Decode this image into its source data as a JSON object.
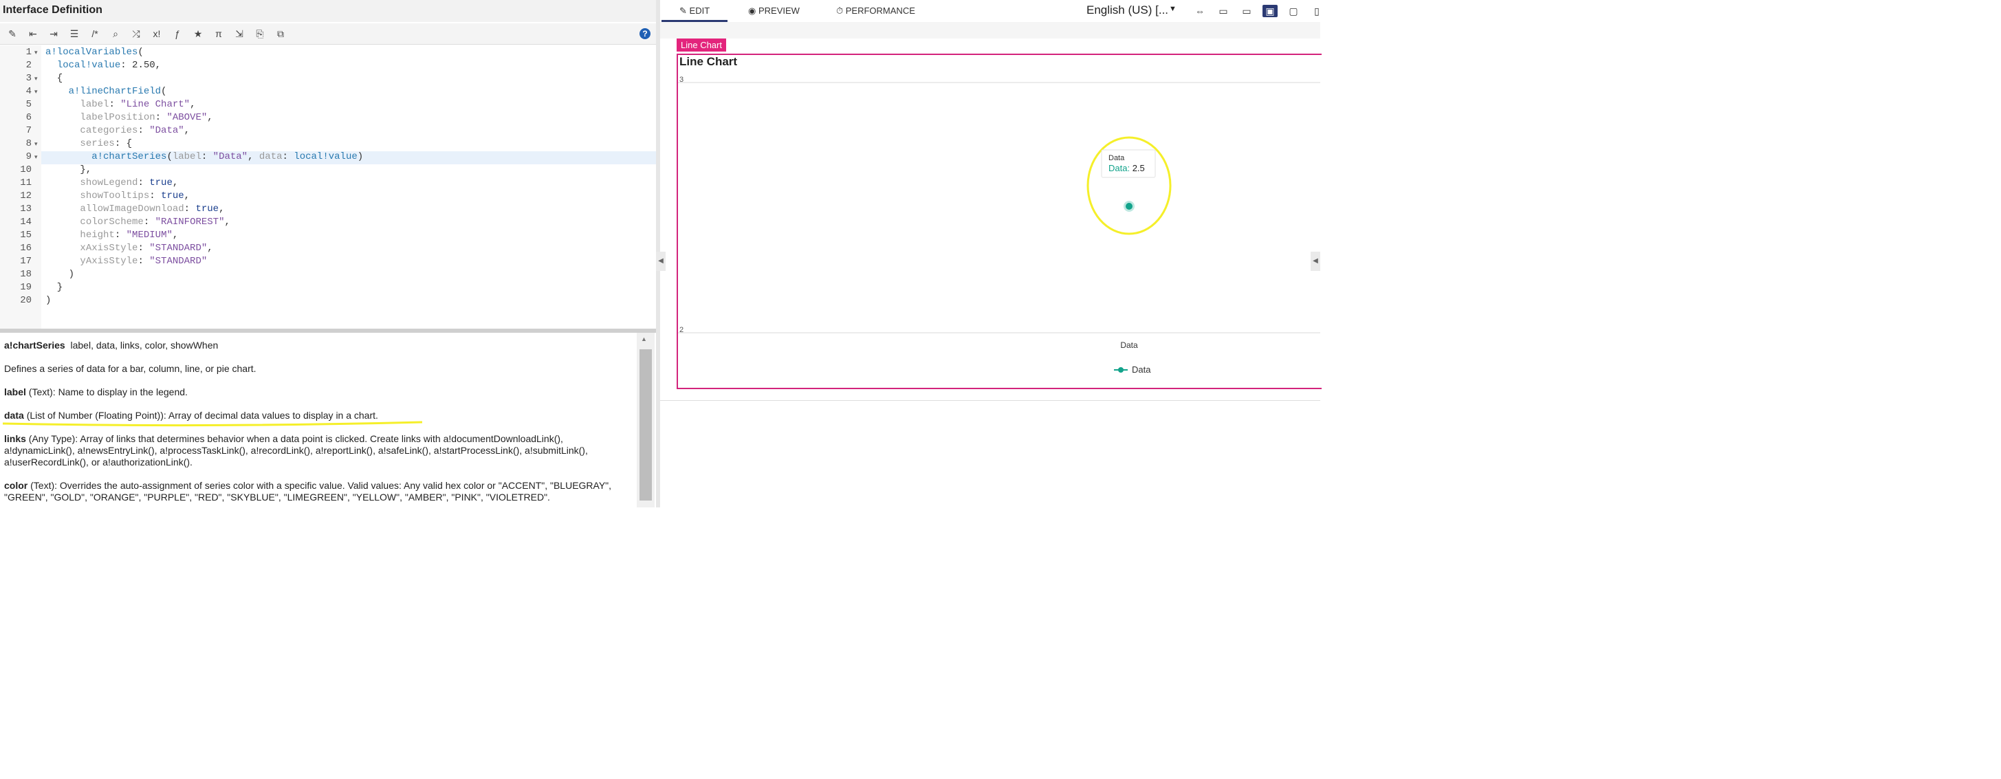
{
  "left": {
    "title": "Interface Definition",
    "help": "?",
    "toolbar": [
      {
        "icon": "wand-icon",
        "glyph": "✎"
      },
      {
        "icon": "outdent-icon",
        "glyph": "⇤"
      },
      {
        "icon": "indent-icon",
        "glyph": "⇥"
      },
      {
        "icon": "format-icon",
        "glyph": "☰"
      },
      {
        "icon": "comment-icon",
        "glyph": "/*"
      },
      {
        "icon": "search-icon",
        "glyph": "⌕"
      },
      {
        "icon": "shuffle-icon",
        "glyph": "⤮"
      },
      {
        "icon": "expression-icon",
        "glyph": "x!"
      },
      {
        "icon": "function-icon",
        "glyph": "ƒ"
      },
      {
        "icon": "star-icon",
        "glyph": "★"
      },
      {
        "icon": "pi-icon",
        "glyph": "π"
      },
      {
        "icon": "export-icon",
        "glyph": "⇲"
      },
      {
        "icon": "copy-icon",
        "glyph": "⎘"
      },
      {
        "icon": "layers-icon",
        "glyph": "⧉"
      }
    ],
    "code_lines": [
      "a!localVariables(",
      "  local!value: 2.50,",
      "  {",
      "    a!lineChartField(",
      "      label: \"Line Chart\",",
      "      labelPosition: \"ABOVE\",",
      "      categories: \"Data\",",
      "      series: {",
      "        a!chartSeries(label: \"Data\", data: local!value)",
      "      },",
      "      showLegend: true,",
      "      showTooltips: true,",
      "      allowImageDownload: true,",
      "      colorScheme: \"RAINFOREST\",",
      "      height: \"MEDIUM\",",
      "      xAxisStyle: \"STANDARD\",",
      "      yAxisStyle: \"STANDARD\"",
      "    )",
      "  }",
      ")"
    ],
    "fold_lines": [
      1,
      3,
      4,
      8,
      9
    ],
    "doc": {
      "fn_name": "a!chartSeries",
      "fn_params": "label, data, links, color, showWhen",
      "description": "Defines a series of data for a bar, column, line, or pie chart.",
      "label_name": "label",
      "label_desc": "(Text): Name to display in the legend.",
      "data_name": "data",
      "data_desc": "(List of Number (Floating Point)): Array of decimal data values to display in a chart.",
      "links_name": "links",
      "links_desc": "(Any Type): Array of links that determines behavior when a data point is clicked. Create links with a!documentDownloadLink(), a!dynamicLink(), a!newsEntryLink(), a!processTaskLink(), a!recordLink(), a!reportLink(), a!safeLink(), a!startProcessLink(), a!submitLink(), a!userRecordLink(), or a!authorizationLink().",
      "color_name": "color",
      "color_desc": "(Text): Overrides the auto-assignment of series color with a specific value. Valid values: Any valid hex color or \"ACCENT\", \"BLUEGRAY\", \"GREEN\", \"GOLD\", \"ORANGE\", \"PURPLE\", \"RED\", \"SKYBLUE\", \"LIMEGREEN\", \"YELLOW\", \"AMBER\", \"PINK\", \"VIOLETRED\"."
    }
  },
  "right": {
    "tabs": [
      {
        "label": "EDIT",
        "icon": "edit-icon",
        "glyph": "✎"
      },
      {
        "label": "PREVIEW",
        "icon": "eye-icon",
        "glyph": "◉"
      },
      {
        "label": "PERFORMANCE",
        "icon": "timer-icon",
        "glyph": "⏱"
      }
    ],
    "language": "English (US) [...",
    "devices": [
      {
        "icon": "fit-width-icon",
        "glyph": "⇔"
      },
      {
        "icon": "desktop-icon",
        "glyph": "▭"
      },
      {
        "icon": "monitor-icon",
        "glyph": "▭"
      },
      {
        "icon": "laptop-icon",
        "glyph": "▣"
      },
      {
        "icon": "tablet-icon",
        "glyph": "▢"
      },
      {
        "icon": "phone-icon",
        "glyph": "▯"
      }
    ],
    "selected_device": 3,
    "tag": "Line Chart",
    "legend_label": "Data",
    "tooltip": {
      "title": "Data",
      "series": "Data",
      "value": "2.5"
    }
  },
  "chart_data": {
    "type": "line",
    "title": "Line Chart",
    "categories": [
      "Data"
    ],
    "series": [
      {
        "name": "Data",
        "values": [
          2.5
        ]
      }
    ],
    "ylim": [
      2,
      3
    ],
    "yticks": [
      "3",
      "2"
    ],
    "legend": "bottom",
    "grid": true
  },
  "colors": {
    "accent": "#2b3a73",
    "chart_border": "#d3247c",
    "tag_bg": "#e3247c",
    "series": "#12a38b",
    "annotation": "#f5ef2a"
  }
}
